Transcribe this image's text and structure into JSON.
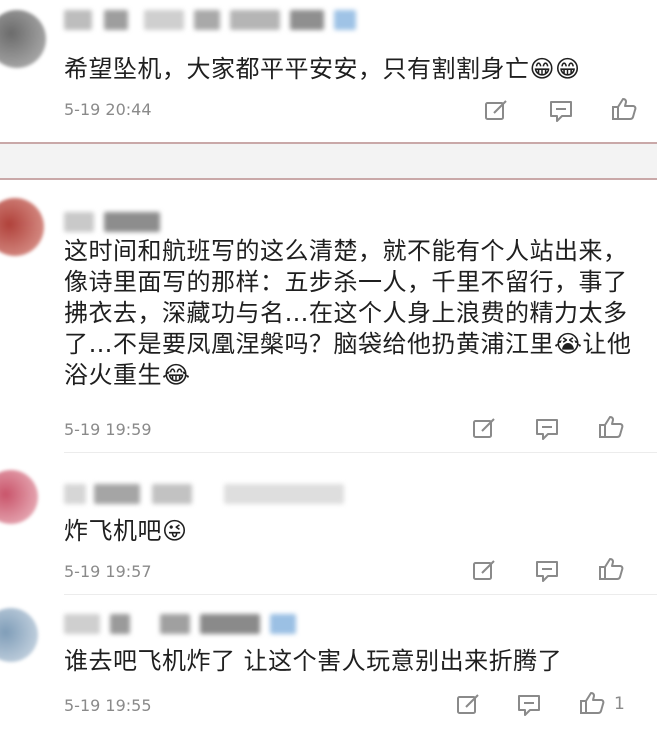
{
  "comments": [
    {
      "text": "希望坠机，大家都平平安安，只有割割身亡😁😁",
      "time": "5-19 20:44"
    },
    {
      "text": "这时间和航班写的这么清楚，就不能有个人站出来，像诗里面写的那样：五步杀一人，千里不留行，事了拂衣去，深藏功与名…在这个人身上浪费的精力太多了…不是要凤凰涅槃吗？脑袋给他扔黄浦江里😭让他浴火重生😂",
      "time": "5-19 19:59"
    },
    {
      "text": "炸飞机吧😜",
      "time": "5-19 19:57"
    },
    {
      "text": "谁去吧飞机炸了 让这个害人玩意别出来折腾了",
      "time": "5-19 19:55",
      "like_count": "1"
    }
  ],
  "icons": {
    "reply": "edit-square-icon",
    "comment": "comment-bubble-icon",
    "like": "thumbs-up-icon"
  },
  "colors": {
    "text": "#1f1f1f",
    "meta": "#8a8a8a",
    "divider": "#c9a8a8"
  }
}
